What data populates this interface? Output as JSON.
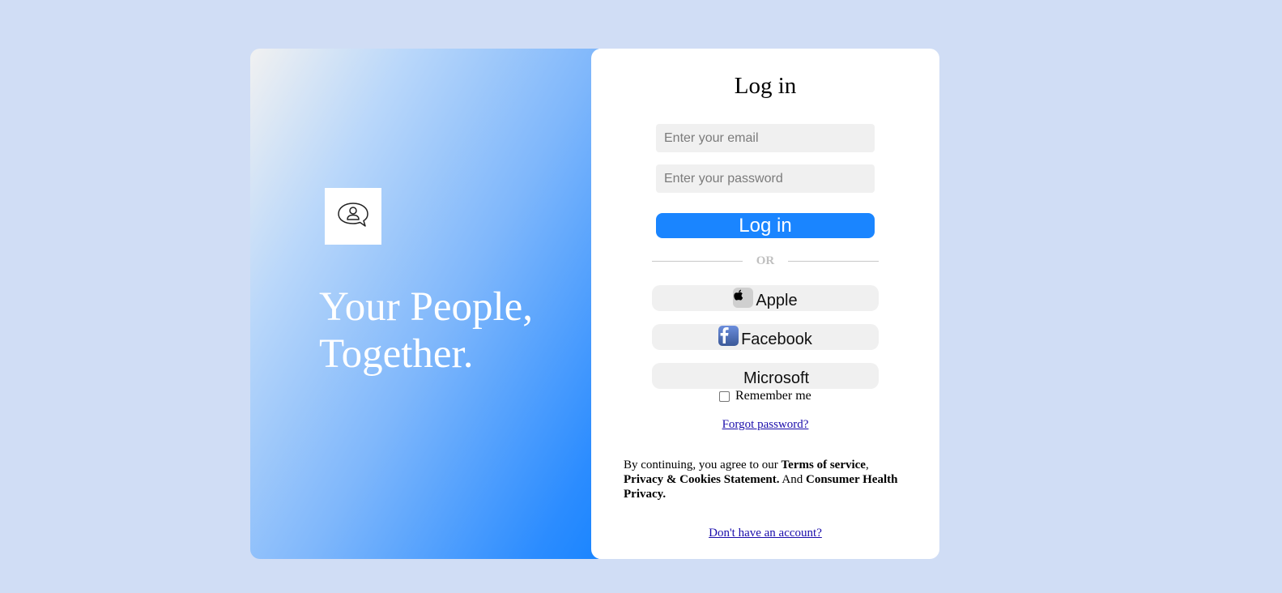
{
  "hero": {
    "tagline_line1": "Your People,",
    "tagline_line2": "Together.",
    "logo_icon": "chat-user-icon",
    "gradient_colors": [
      "#f1f1f1",
      "#b9d7fa",
      "#7fb7fb",
      "#2b8cff",
      "#1a85ff"
    ]
  },
  "login": {
    "title": "Log in",
    "email_placeholder": "Enter your email",
    "password_placeholder": "Enter your password",
    "submit_label": "Log in",
    "divider_text": "OR",
    "social": [
      {
        "label": "Apple",
        "icon": "apple-icon"
      },
      {
        "label": "Facebook",
        "icon": "facebook-icon"
      },
      {
        "label": "Microsoft",
        "icon": "microsoft-icon"
      }
    ],
    "remember_label": "Remember me",
    "remember_checked": false,
    "forgot_link": "Forgot password?",
    "legal": {
      "prefix": "By continuing, you agree to our ",
      "terms": "Terms of service",
      "comma": ",",
      "privacy": "Privacy & Cookies Statement.",
      "and": " And ",
      "consumer": "Consumer Health Privacy."
    },
    "signup_link": "Don't have an account?"
  },
  "colors": {
    "page_background": "#d0ddf5",
    "accent": "#1a85ff",
    "input_background": "#f0f0f0",
    "link": "#1a0dab",
    "microsoft": [
      "#f25022",
      "#7fba00",
      "#00a4ef",
      "#ffb900"
    ]
  }
}
